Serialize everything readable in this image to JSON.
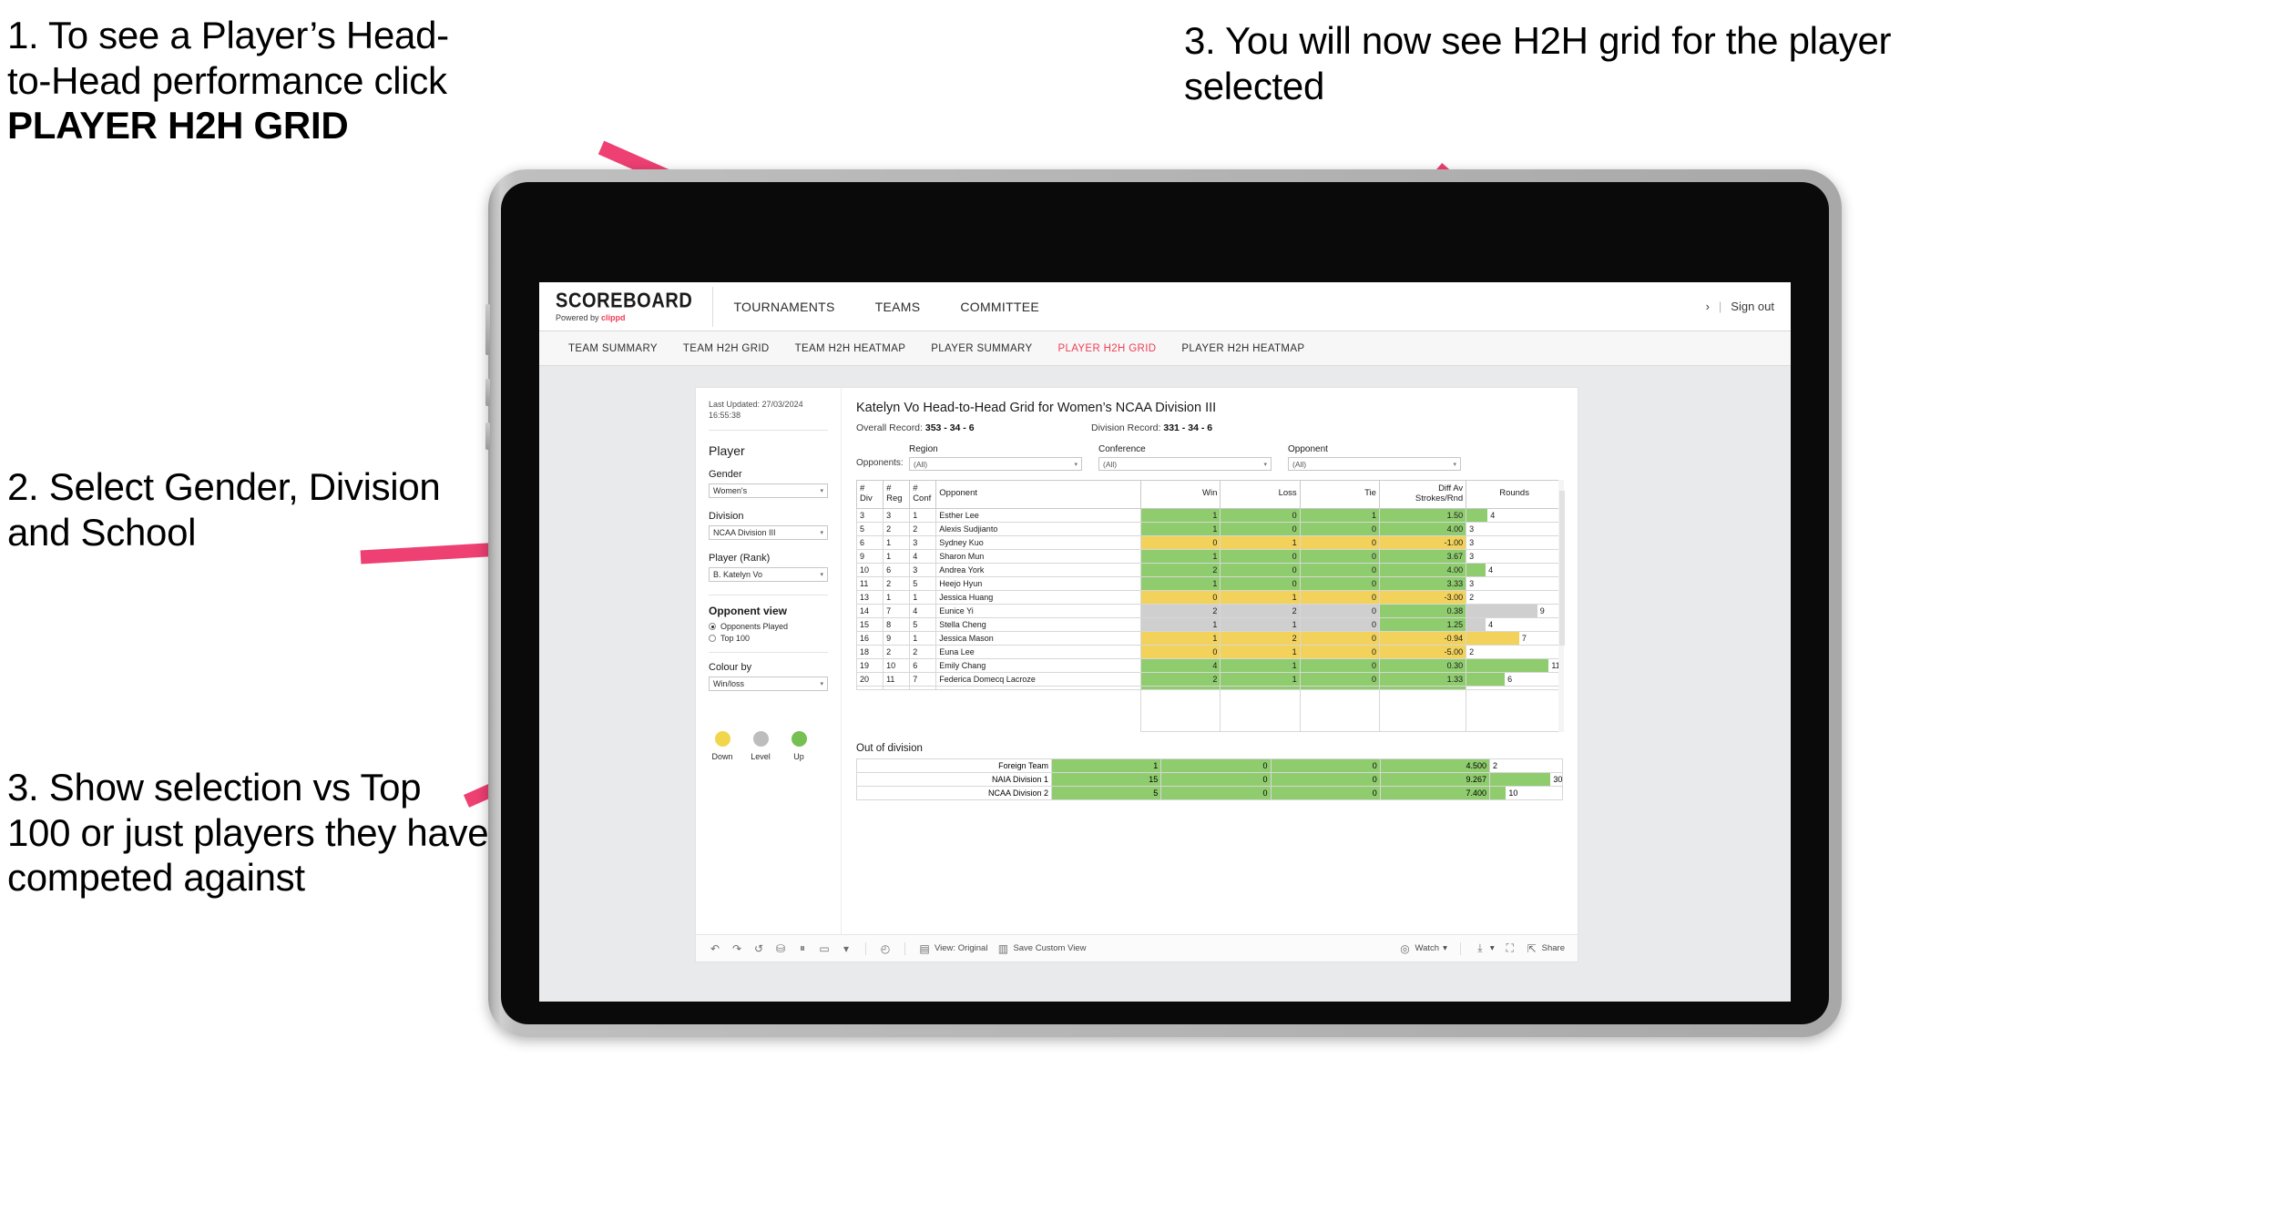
{
  "annotations": {
    "a1_line1": "1. To see a Player’s Head-",
    "a1_line2": "to-Head performance click",
    "a1_bold": "PLAYER H2H GRID",
    "a2": "2. Select Gender, Division and School",
    "a3": "3. Show selection vs Top 100 or just players they have competed against",
    "a4": "3. You will now see H2H grid for the player selected"
  },
  "app": {
    "brand": {
      "title": "SCOREBOARD",
      "powered_prefix": "Powered by ",
      "powered_brand": "clippd"
    },
    "main_nav": [
      "TOURNAMENTS",
      "TEAMS",
      "COMMITTEE"
    ],
    "header_right": {
      "chevron": "›",
      "separator": "|",
      "sign_out": "Sign out"
    },
    "sub_nav": [
      {
        "label": "TEAM SUMMARY",
        "active": false
      },
      {
        "label": "TEAM H2H GRID",
        "active": false
      },
      {
        "label": "TEAM H2H HEATMAP",
        "active": false
      },
      {
        "label": "PLAYER SUMMARY",
        "active": false
      },
      {
        "label": "PLAYER H2H GRID",
        "active": true
      },
      {
        "label": "PLAYER H2H HEATMAP",
        "active": false
      }
    ],
    "accent_color": "#ef3e56"
  },
  "sidebar": {
    "last_updated": "Last Updated: 27/03/2024 16:55:38",
    "section_title": "Player",
    "fields": [
      {
        "label": "Gender",
        "value": "Women's"
      },
      {
        "label": "Division",
        "value": "NCAA Division III"
      },
      {
        "label": "Player (Rank)",
        "value": "B. Katelyn Vo"
      }
    ],
    "opponent_view": {
      "title": "Opponent view",
      "options": [
        {
          "label": "Opponents Played",
          "selected": true
        },
        {
          "label": "Top 100",
          "selected": false
        }
      ]
    },
    "colour_by": {
      "label": "Colour by",
      "value": "Win/loss"
    },
    "legend": [
      {
        "label": "Down",
        "color": "#f1d64b"
      },
      {
        "label": "Level",
        "color": "#bdbdbd"
      },
      {
        "label": "Up",
        "color": "#76bf52"
      }
    ]
  },
  "viz": {
    "title": "Katelyn Vo Head-to-Head Grid for Women’s NCAA Division III",
    "overall_record_label": "Overall Record: ",
    "overall_record_value": "353 -  34 - 6",
    "division_record_label": "Division Record: ",
    "division_record_value": "331 -  34 - 6",
    "opponents_label": "Opponents:",
    "opponent_filters": [
      {
        "label": "Region",
        "value": "(All)"
      },
      {
        "label": "Conference",
        "value": "(All)"
      },
      {
        "label": "Opponent",
        "value": "(All)"
      }
    ],
    "columns": [
      "# Div",
      "# Reg",
      "# Conf",
      "Opponent",
      "Win",
      "Loss",
      "Tie",
      "Diff Av Strokes/Rnd",
      "Rounds"
    ],
    "column_lines": [
      [
        "#",
        "Div"
      ],
      [
        "#",
        "Reg"
      ],
      [
        "#",
        "Conf"
      ],
      [
        "Opponent",
        ""
      ],
      [
        "Win",
        ""
      ],
      [
        "Loss",
        ""
      ],
      [
        "Tie",
        ""
      ],
      [
        "Diff Av",
        "Strokes/Rnd"
      ],
      [
        "Rounds",
        ""
      ]
    ],
    "out_of_division_title": "Out of division"
  },
  "chart_data": {
    "type": "table",
    "title": "Katelyn Vo Head-to-Head Grid for Women’s NCAA Division III",
    "columns": [
      "# Div",
      "# Reg",
      "# Conf",
      "Opponent",
      "Win",
      "Loss",
      "Tie",
      "Diff Av Strokes/Rnd",
      "Rounds"
    ],
    "rows": [
      {
        "div": "3",
        "reg": "3",
        "conf": "1",
        "opponent": "Esther Lee",
        "win": "1",
        "loss": "0",
        "tie": "1",
        "diff": "1.50",
        "rounds": "4",
        "rounds_pct": 22,
        "color": "#8fcc6e"
      },
      {
        "div": "5",
        "reg": "2",
        "conf": "2",
        "opponent": "Alexis Sudjianto",
        "win": "1",
        "loss": "0",
        "tie": "0",
        "diff": "4.00",
        "rounds": "3",
        "rounds_pct": 0,
        "color": "#8fcc6e"
      },
      {
        "div": "6",
        "reg": "1",
        "conf": "3",
        "opponent": "Sydney Kuo",
        "win": "0",
        "loss": "1",
        "tie": "0",
        "diff": "-1.00",
        "rounds": "3",
        "rounds_pct": 0,
        "color": "#f2d25b"
      },
      {
        "div": "9",
        "reg": "1",
        "conf": "4",
        "opponent": "Sharon Mun",
        "win": "1",
        "loss": "0",
        "tie": "0",
        "diff": "3.67",
        "rounds": "3",
        "rounds_pct": 0,
        "color": "#8fcc6e"
      },
      {
        "div": "10",
        "reg": "6",
        "conf": "3",
        "opponent": "Andrea York",
        "win": "2",
        "loss": "0",
        "tie": "0",
        "diff": "4.00",
        "rounds": "4",
        "rounds_pct": 20,
        "color": "#8fcc6e"
      },
      {
        "div": "11",
        "reg": "2",
        "conf": "5",
        "opponent": "Heejo Hyun",
        "win": "1",
        "loss": "0",
        "tie": "0",
        "diff": "3.33",
        "rounds": "3",
        "rounds_pct": 0,
        "color": "#8fcc6e"
      },
      {
        "div": "13",
        "reg": "1",
        "conf": "1",
        "opponent": "Jessica Huang",
        "win": "0",
        "loss": "1",
        "tie": "0",
        "diff": "-3.00",
        "rounds": "2",
        "rounds_pct": 0,
        "color": "#f2d25b"
      },
      {
        "div": "14",
        "reg": "7",
        "conf": "4",
        "opponent": "Eunice Yi",
        "win": "2",
        "loss": "2",
        "tie": "0",
        "diff": "0.38",
        "rounds": "9",
        "rounds_pct": 74,
        "color": "#cfcfcf"
      },
      {
        "div": "15",
        "reg": "8",
        "conf": "5",
        "opponent": "Stella Cheng",
        "win": "1",
        "loss": "1",
        "tie": "0",
        "diff": "1.25",
        "rounds": "4",
        "rounds_pct": 20,
        "color": "#cfcfcf"
      },
      {
        "div": "16",
        "reg": "9",
        "conf": "1",
        "opponent": "Jessica Mason",
        "win": "1",
        "loss": "2",
        "tie": "0",
        "diff": "-0.94",
        "rounds": "7",
        "rounds_pct": 55,
        "color": "#f2d25b"
      },
      {
        "div": "18",
        "reg": "2",
        "conf": "2",
        "opponent": "Euna Lee",
        "win": "0",
        "loss": "1",
        "tie": "0",
        "diff": "-5.00",
        "rounds": "2",
        "rounds_pct": 0,
        "color": "#f2d25b"
      },
      {
        "div": "19",
        "reg": "10",
        "conf": "6",
        "opponent": "Emily Chang",
        "win": "4",
        "loss": "1",
        "tie": "0",
        "diff": "0.30",
        "rounds": "11",
        "rounds_pct": 86,
        "color": "#8fcc6e"
      },
      {
        "div": "20",
        "reg": "11",
        "conf": "7",
        "opponent": "Federica Domecq Lacroze",
        "win": "2",
        "loss": "1",
        "tie": "0",
        "diff": "1.33",
        "rounds": "6",
        "rounds_pct": 40,
        "color": "#8fcc6e"
      }
    ],
    "out_of_division": {
      "title": "Out of division",
      "rows": [
        {
          "name": "Foreign Team",
          "win": "1",
          "loss": "0",
          "tie": "0",
          "diff": "4.500",
          "rounds": "2",
          "rounds_pct": 0,
          "color": "#8fcc6e"
        },
        {
          "name": "NAIA Division 1",
          "win": "15",
          "loss": "0",
          "tie": "0",
          "diff": "9.267",
          "rounds": "30",
          "rounds_pct": 84,
          "color": "#8fcc6e"
        },
        {
          "name": "NCAA Division 2",
          "win": "5",
          "loss": "0",
          "tie": "0",
          "diff": "7.400",
          "rounds": "10",
          "rounds_pct": 22,
          "color": "#8fcc6e"
        }
      ]
    }
  },
  "toolbar": {
    "undo": "↶",
    "redo": "↷",
    "revert": "↺",
    "refresh": "⛁",
    "pause": "⏸",
    "device": "▭",
    "caret": "▾",
    "clock": "◴",
    "view_original": "View: Original",
    "save_custom_view": "Save Custom View",
    "watch": "Watch",
    "share": "Share"
  }
}
